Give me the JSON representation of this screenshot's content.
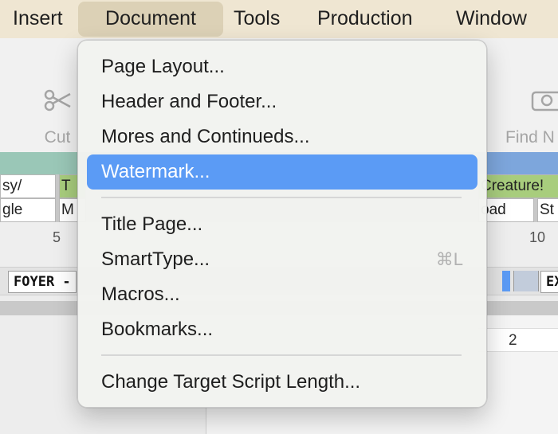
{
  "menubar": {
    "items": [
      {
        "label": "Insert"
      },
      {
        "label": "Document"
      },
      {
        "label": "Tools"
      },
      {
        "label": "Production"
      },
      {
        "label": "Window"
      }
    ]
  },
  "toolbar": {
    "cut_label": "Cut",
    "find_label": "Find N"
  },
  "tags": {
    "row1": [
      "sy/",
      "T",
      "Creature!"
    ],
    "row2": [
      "gle",
      "M",
      "oad",
      "St"
    ]
  },
  "ruler": {
    "marks": [
      "5",
      "10"
    ]
  },
  "scene": {
    "left_chip": "FOYER -",
    "right_chip": "EX"
  },
  "page": {
    "number": "2"
  },
  "document_menu": {
    "items": [
      {
        "label": "Page Layout..."
      },
      {
        "label": "Header and Footer..."
      },
      {
        "label": "Mores and Continueds..."
      },
      {
        "label": "Watermark..."
      },
      {
        "label": "Title Page..."
      },
      {
        "label": "SmartType...",
        "shortcut": "⌘L"
      },
      {
        "label": "Macros..."
      },
      {
        "label": "Bookmarks..."
      },
      {
        "label": "Change Target Script Length..."
      }
    ],
    "selected_index": 3
  },
  "colors": {
    "selection": "#5b9bf5",
    "menubar_bg": "#efe6d2",
    "teal_strip": "#9ac7b7"
  }
}
